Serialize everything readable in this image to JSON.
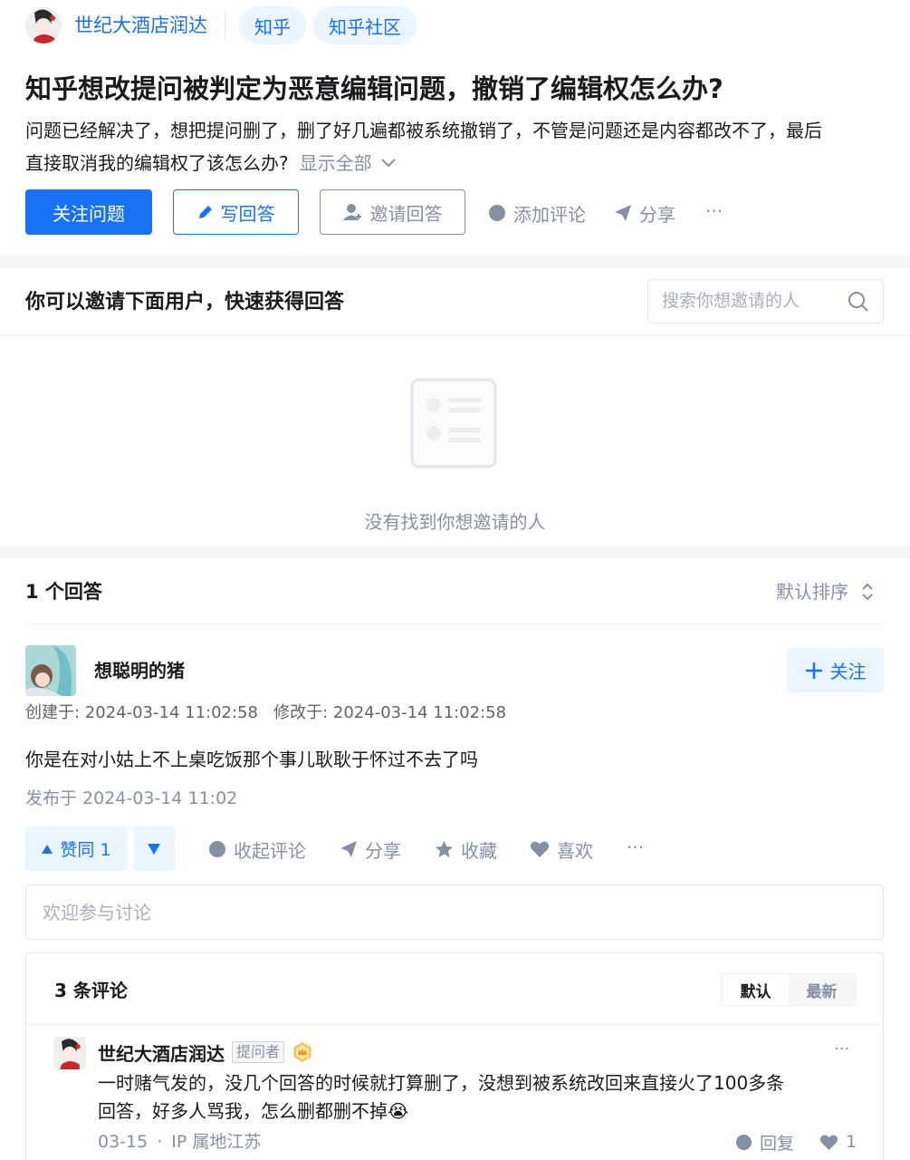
{
  "header": {
    "account_name": "世纪大酒店润达",
    "tags": [
      "知乎",
      "知乎社区"
    ]
  },
  "question": {
    "title": "知乎想改提问被判定为恶意编辑问题，撤销了编辑权怎么办?",
    "detail_line1": "问题已经解决了，想把提问删了，删了好几遍都被系统撤销了，不管是问题还是内容都改不了，最后",
    "detail_line2": "直接取消我的编辑权了该怎么办?",
    "show_all": "显示全部",
    "buttons": {
      "follow": "关注问题",
      "write": "写回答",
      "invite": "邀请回答",
      "comment": "添加评论",
      "share": "分享",
      "more": "···"
    }
  },
  "invite": {
    "title": "你可以邀请下面用户，快速获得回答",
    "search_placeholder": "搜索你想邀请的人",
    "empty_text": "没有找到你想邀请的人"
  },
  "answers": {
    "count_label": "1 个回答",
    "sort_label": "默认排序",
    "item": {
      "author": "想聪明的猪",
      "follow_label": "关注",
      "meta": "创建于: 2024-03-14 11:02:58   修改于: 2024-03-14 11:02:58",
      "content": "你是在对小姑上不上桌吃饭那个事儿耿耿于怀过不去了吗",
      "published": "发布于 2024-03-14 11:02",
      "actions": {
        "upvote": "赞同 1",
        "collapse_comments": "收起评论",
        "share": "分享",
        "collect": "收藏",
        "like": "喜欢",
        "more": "···"
      },
      "comment_input_placeholder": "欢迎参与讨论",
      "comments": {
        "count_label": "3 条评论",
        "tab_default": "默认",
        "tab_newest": "最新",
        "first": {
          "author": "世纪大酒店润达",
          "badge": "提问者",
          "line1": "一时赌气发的，没几个回答的时候就打算删了，没想到被系统改回来直接火了100多条",
          "line2": "回答，好多人骂我，怎么删都删不掉",
          "emoji": "😭",
          "date": "03-15",
          "dot": "·",
          "ip": "IP 属地江苏",
          "reply": "回复",
          "likes": "1",
          "more": "···"
        }
      }
    }
  },
  "colors": {
    "brand_blue": "#1772f6",
    "muted": "#8491a5",
    "tag_bg": "#ebf5ff"
  }
}
